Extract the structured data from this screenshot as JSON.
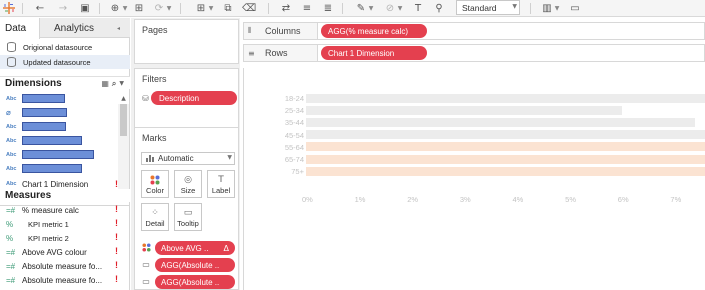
{
  "toolbar": {
    "fit": "Standard",
    "colors": {
      "icon": "#555555",
      "disabled": "#b5b5b5",
      "brand_dots": [
        "#e8762c",
        "#5b6fd6",
        "#e4404f",
        "#59a14f"
      ]
    }
  },
  "data_pane": {
    "tabs": [
      "Data",
      "Analytics"
    ],
    "datasources": [
      {
        "label": "Origional datasource",
        "selected": false
      },
      {
        "label": "Updated datasource",
        "selected": true
      }
    ],
    "dimensions_title": "Dimensions",
    "dimensions": [
      {
        "type": "Abc",
        "label": "",
        "redacted": true
      },
      {
        "type": "Abc",
        "label": "",
        "redacted": true
      },
      {
        "type": "Abc",
        "label": "",
        "redacted": true
      },
      {
        "type": "Abc",
        "label": "",
        "redacted": true
      },
      {
        "type": "Abc",
        "label": "",
        "redacted": true
      },
      {
        "type": "Abc",
        "label": "",
        "redacted": true
      },
      {
        "type": "Abc",
        "label": "Chart 1 Dimension",
        "redacted": false,
        "error": "!"
      }
    ],
    "measures_title": "Measures",
    "measures": [
      {
        "type": "=#",
        "label": "% measure calc",
        "error": "!"
      },
      {
        "type": "%",
        "label": "KPI metric 1",
        "error": "!"
      },
      {
        "type": "%",
        "label": "KPI metric 2",
        "error": "!"
      },
      {
        "type": "=#",
        "label": "Above AVG colour",
        "error": "!"
      },
      {
        "type": "=#",
        "label": "Absolute measure fo...",
        "error": "!"
      },
      {
        "type": "=#",
        "label": "Absolute measure fo...",
        "error": "!"
      }
    ]
  },
  "pages": {
    "title": "Pages"
  },
  "filters": {
    "title": "Filters",
    "items": [
      "Description"
    ]
  },
  "marks": {
    "title": "Marks",
    "type": "Automatic",
    "buttons": [
      "Color",
      "Size",
      "Label",
      "Detail",
      "Tooltip"
    ],
    "encodings": [
      {
        "icon": "color-dots",
        "label": "Above AVG ..",
        "suffix": "Δ"
      },
      {
        "icon": "tooltip",
        "label": "AGG(Absolute .."
      },
      {
        "icon": "tooltip",
        "label": "AGG(Absolute .."
      }
    ]
  },
  "shelves": {
    "columns_label": "Columns",
    "columns_pill": "AGG(% measure calc)",
    "rows_label": "Rows",
    "rows_pill": "Chart 1 Dimension",
    "pill_color": "#e4404f"
  },
  "chart_data": {
    "type": "bar",
    "orientation": "horizontal",
    "categories": [
      "18-24",
      "25-34",
      "35-44",
      "45-54",
      "55-64",
      "65-74",
      "75+"
    ],
    "values": [
      8.5,
      6.0,
      7.4,
      8.5,
      8.5,
      8.5,
      8.5
    ],
    "colors": [
      "#ececec",
      "#ececec",
      "#ececec",
      "#ececec",
      "#fbe3d2",
      "#fbe3d2",
      "#fbe3d2"
    ],
    "xticks": [
      "0%",
      "1%",
      "2%",
      "3%",
      "4%",
      "5%",
      "6%",
      "7%"
    ],
    "xlim": [
      0,
      7.6
    ],
    "grid": false
  }
}
